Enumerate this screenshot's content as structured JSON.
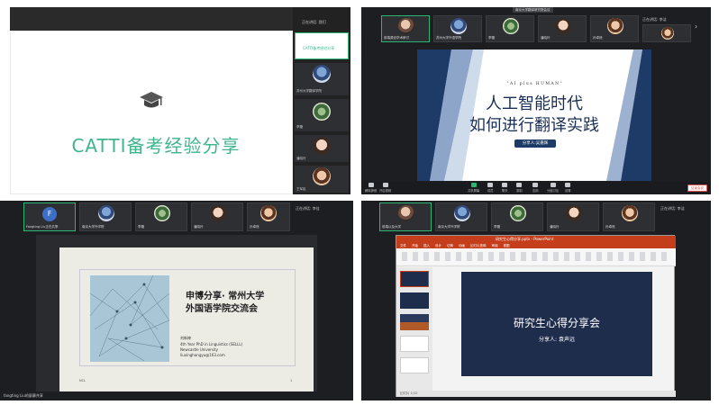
{
  "panels": {
    "p1": {
      "title": "CATTI备考经验分享",
      "sidebar_title": "正在讲话: 我们",
      "participants": [
        "苏州大学翻译学院",
        "李璐",
        "潘晓玲",
        "王军民"
      ],
      "share_label": "CATTI备考经验分享",
      "icon": "graduation-cap-icon",
      "accent": "#3fb58c"
    },
    "p2": {
      "meeting_title": "南京大学翻译研究院会议",
      "participants": [
        "前端源自学术研讨",
        "苏州大学外语学院",
        "李璐",
        "潘晓玲",
        "孙卓然"
      ],
      "speaking": "正在讲话: 李洁",
      "slide": {
        "kicker": "\" A I   p l u s   H U M A N \"",
        "line1": "人工智能时代",
        "line2": "如何进行翻译实践",
        "badge": "分享人:吴嘉辉"
      },
      "controls": [
        "解除静音",
        "开启视频",
        "共享屏幕",
        "成员",
        "聊天",
        "录制",
        "应用",
        "分组讨论",
        "设置"
      ],
      "leave": "结束会议"
    },
    "p3": {
      "avatar_letter": "F",
      "participants": [
        "Fangting Liu正在共享",
        "南京大学外学院",
        "李璐",
        "潘晓玲",
        "孙卓然"
      ],
      "speaking": "正在讲话: 李佳",
      "slide": {
        "title1": "申博分享· 常州大学",
        "title2": "外国语学院交流会",
        "name": "刘新婷",
        "degree": "4th Year PhD in Linguistics (SELLL)",
        "uni": "Newcastle University",
        "email": "liuxinghangyu@163.com",
        "page": "1",
        "footer": "NCL"
      },
      "bottom_label": "fangting Liu的屏幕共享"
    },
    "p4": {
      "participants": [
        "前端以及大学",
        "南京大学外学院",
        "李璐",
        "潘晓玲",
        "孙卓然"
      ],
      "speaking": "正在讲话: 李洁",
      "ppt": {
        "title_bar": "研究生心得分享.pptx - PowerPoint",
        "tabs": [
          "文件",
          "开始",
          "插入",
          "设计",
          "切换",
          "动画",
          "幻灯片放映",
          "审阅",
          "视图"
        ],
        "slide_title": "研究生心得分享会",
        "slide_subtitle": "分享人: 袁声远",
        "thumbs": [
          "1",
          "2",
          "3",
          "4",
          "5"
        ],
        "status": "幻灯片 1/12"
      }
    }
  }
}
